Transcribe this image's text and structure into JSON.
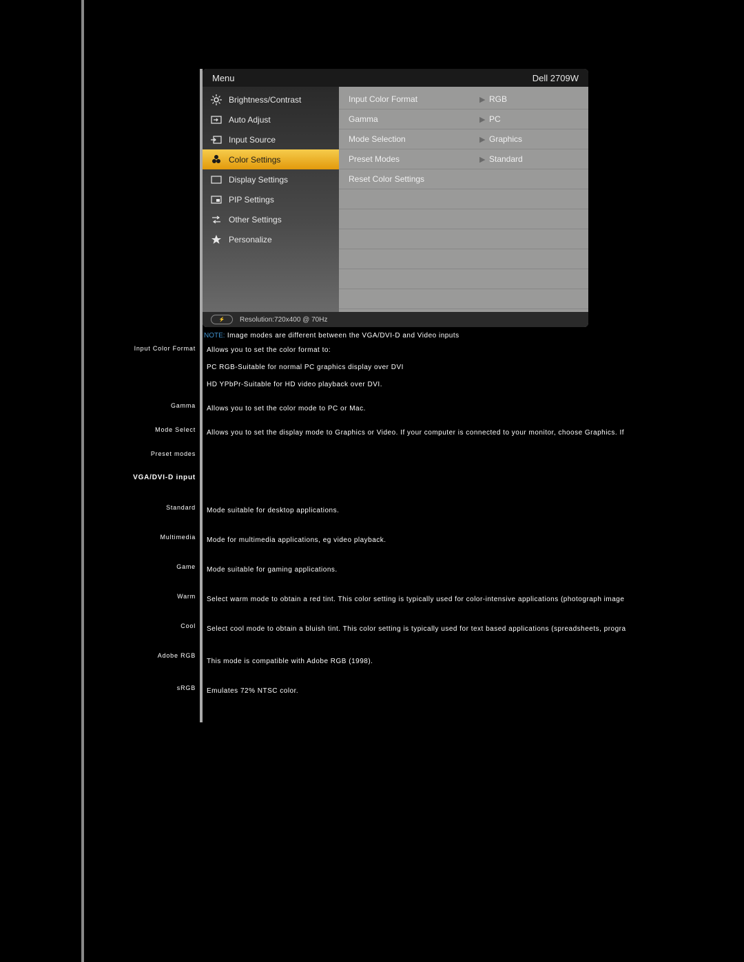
{
  "osd": {
    "title": "Menu",
    "model": "Dell 2709W",
    "left_items": [
      {
        "label": "Brightness/Contrast",
        "selected": false
      },
      {
        "label": "Auto Adjust",
        "selected": false
      },
      {
        "label": "Input Source",
        "selected": false
      },
      {
        "label": "Color Settings",
        "selected": true
      },
      {
        "label": "Display Settings",
        "selected": false
      },
      {
        "label": "PIP Settings",
        "selected": false
      },
      {
        "label": "Other Settings",
        "selected": false
      },
      {
        "label": "Personalize",
        "selected": false
      }
    ],
    "right_rows": [
      {
        "key": "Input Color Format",
        "value": "RGB",
        "arrow": true
      },
      {
        "key": "Gamma",
        "value": "PC",
        "arrow": true
      },
      {
        "key": "Mode Selection",
        "value": "Graphics",
        "arrow": true
      },
      {
        "key": "Preset Modes",
        "value": "Standard",
        "arrow": true
      },
      {
        "key": "Reset Color Settings",
        "value": "",
        "arrow": false
      }
    ],
    "footer_resolution": "Resolution:720x400 @ 70Hz"
  },
  "note_prefix": "NOTE:",
  "note_text": " Image modes are different between the VGA/DVI-D and Video inputs",
  "rows": {
    "input_color_format": {
      "label": "Input Color Format",
      "line1": "Allows you to set the color format to:",
      "line2": "PC RGB-Suitable for normal PC graphics display over DVI",
      "line3": "HD YPbPr-Suitable for HD video playback over DVI."
    },
    "gamma": {
      "label": "Gamma",
      "text": "Allows you to set the color mode to PC or Mac."
    },
    "mode_select": {
      "label": "Mode Select",
      "text": "Allows you to set the display mode to Graphics or Video. If your computer is connected to your monitor, choose Graphics. If"
    },
    "preset_modes": {
      "label": "Preset modes"
    },
    "vga_heading": "VGA/DVI-D input",
    "standard": {
      "label": "Standard",
      "text": "Mode suitable for desktop applications."
    },
    "multimedia": {
      "label": "Multimedia",
      "text": "Mode for multimedia applications, eg video playback."
    },
    "game": {
      "label": "Game",
      "text": "Mode suitable for gaming applications."
    },
    "warm": {
      "label": "Warm",
      "text": "Select warm mode to obtain a red tint. This color setting is typically used for color-intensive applications (photograph image"
    },
    "cool": {
      "label": "Cool",
      "text": "Select cool mode to obtain a bluish tint. This color setting is typically used for text based applications (spreadsheets, progra"
    },
    "adobe_rgb": {
      "label": "Adobe RGB",
      "text": "This mode is compatible with Adobe RGB (1998)."
    },
    "srgb": {
      "label": "sRGB",
      "text": "Emulates 72% NTSC color."
    }
  }
}
